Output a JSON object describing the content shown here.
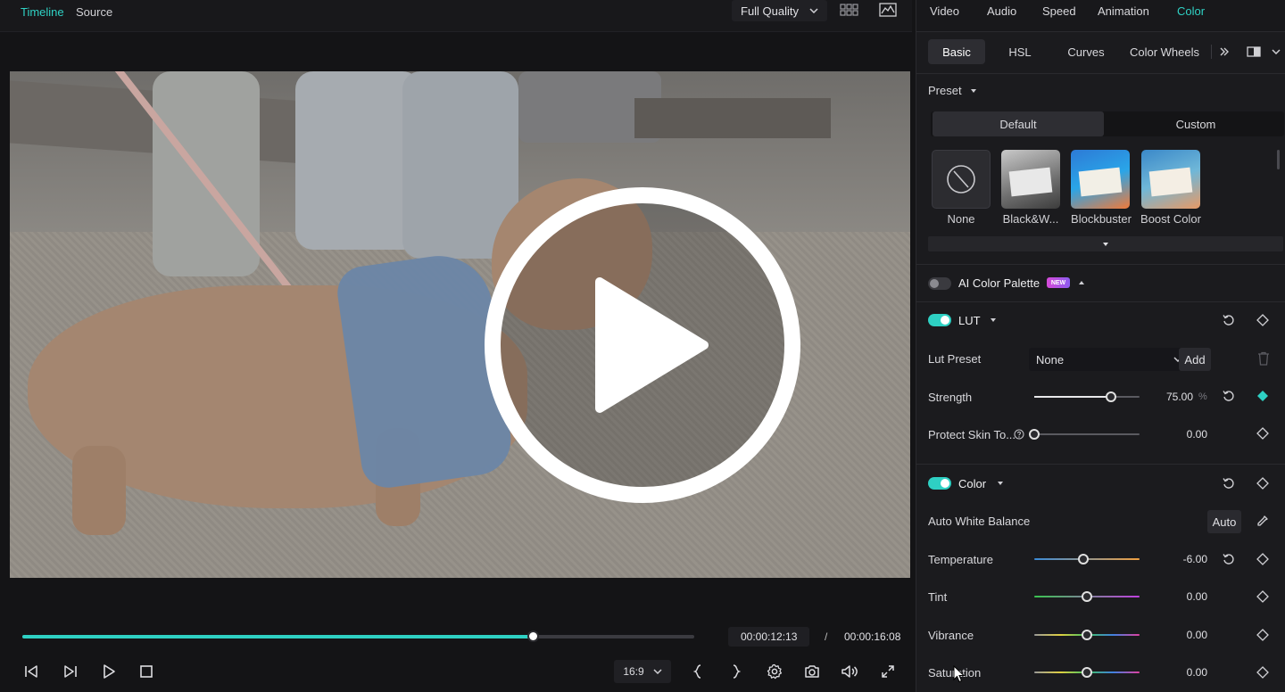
{
  "player": {
    "tabs": [
      {
        "label": "Timeline"
      },
      {
        "label": "Source"
      }
    ],
    "quality_label": "Full Quality",
    "current_time": "00:00:12:13",
    "separator": "/",
    "total_time": "00:00:16:08",
    "progress_fraction": 0.76,
    "aspect_ratio": "16:9"
  },
  "panel": {
    "tabs": [
      "Video",
      "Audio",
      "Speed",
      "Animation",
      "Color"
    ],
    "active_tab": "Color",
    "subtabs": [
      "Basic",
      "HSL",
      "Curves",
      "Color Wheels"
    ],
    "preset": {
      "label": "Preset",
      "options": [
        "Default",
        "Custom"
      ],
      "items": [
        "None",
        "Black&W...",
        "Blockbuster",
        "Boost Color"
      ]
    },
    "ai_palette": {
      "label": "AI Color Palette",
      "badge": "NEW"
    },
    "lut": {
      "label": "LUT",
      "lut_preset_label": "Lut Preset",
      "lut_preset_value": "None",
      "add_label": "Add",
      "strength_label": "Strength",
      "strength_value": "75.00",
      "strength_unit": "%",
      "strength_fraction": 0.73,
      "protect_label": "Protect Skin To...",
      "protect_value": "0.00",
      "protect_fraction": 0.0
    },
    "color": {
      "label": "Color",
      "awb_label": "Auto White Balance",
      "auto_label": "Auto",
      "temperature_label": "Temperature",
      "temperature_value": "-6.00",
      "temperature_fraction": 0.47,
      "tint_label": "Tint",
      "tint_value": "0.00",
      "tint_fraction": 0.5,
      "vibrance_label": "Vibrance",
      "vibrance_value": "0.00",
      "vibrance_fraction": 0.5,
      "saturation_label": "Saturation",
      "saturation_value": "0.00",
      "saturation_fraction": 0.5
    }
  },
  "colors": {
    "accent": "#2ed0c3",
    "panel_bg": "#1b1b1e",
    "badge_start": "#d64ad8",
    "badge_end": "#8c5cf0"
  },
  "icons": [
    "grid-icon",
    "scope-icon",
    "chevron-down-icon",
    "more-tabs-icon",
    "compare-icon",
    "reset-icon",
    "keyframe-icon",
    "trash-icon",
    "help-icon",
    "eyedropper-icon",
    "prev-frame-icon",
    "next-frame-icon",
    "play-icon",
    "stop-icon",
    "mark-in-icon",
    "mark-out-icon",
    "settings-icon",
    "snapshot-icon",
    "volume-icon",
    "fullscreen-icon"
  ]
}
